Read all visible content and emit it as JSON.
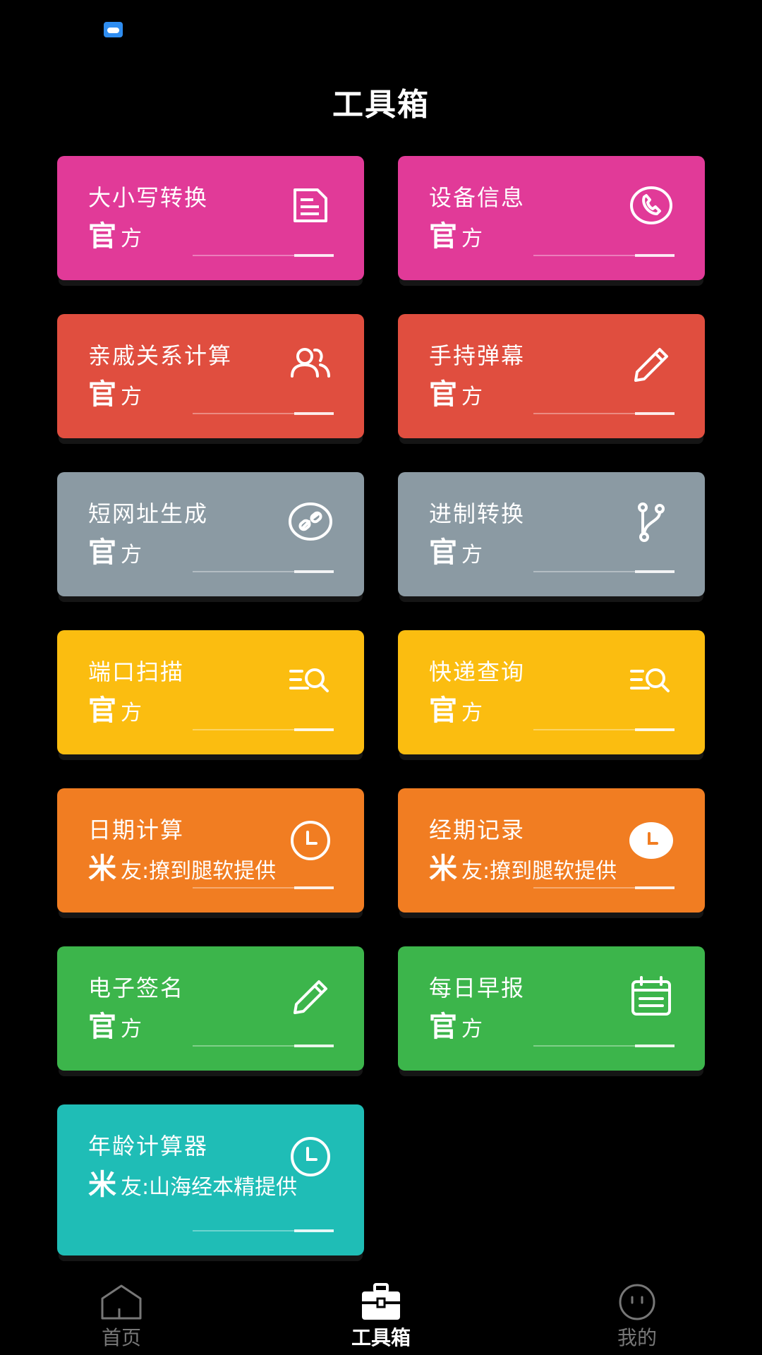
{
  "status_bar": {
    "notification_icon": "weather-app-icon"
  },
  "header": {
    "title": "工具箱"
  },
  "cards": [
    {
      "title": "大小写转换",
      "sub_big": "官",
      "sub_rest": "方",
      "icon": "document-icon",
      "color": "#e13a98"
    },
    {
      "title": "设备信息",
      "sub_big": "官",
      "sub_rest": "方",
      "icon": "phone-icon",
      "color": "#e13a98"
    },
    {
      "title": "亲戚关系计算",
      "sub_big": "官",
      "sub_rest": "方",
      "icon": "people-icon",
      "color": "#e04e3f"
    },
    {
      "title": "手持弹幕",
      "sub_big": "官",
      "sub_rest": "方",
      "icon": "pencil-icon",
      "color": "#e04e3f"
    },
    {
      "title": "短网址生成",
      "sub_big": "官",
      "sub_rest": "方",
      "icon": "link-icon",
      "color": "#8b9aa3"
    },
    {
      "title": "进制转换",
      "sub_big": "官",
      "sub_rest": "方",
      "icon": "branch-icon",
      "color": "#8b9aa3"
    },
    {
      "title": "端口扫描",
      "sub_big": "官",
      "sub_rest": "方",
      "icon": "list-search-icon",
      "color": "#fbbd10"
    },
    {
      "title": "快递查询",
      "sub_big": "官",
      "sub_rest": "方",
      "icon": "list-search-icon",
      "color": "#fbbd10"
    },
    {
      "title": "日期计算",
      "sub_big": "米",
      "sub_rest": "友:撩到腿软提供",
      "icon": "clock-icon",
      "color": "#f17d22"
    },
    {
      "title": "经期记录",
      "sub_big": "米",
      "sub_rest": "友:撩到腿软提供",
      "icon": "clock-filled-icon",
      "color": "#f17d22"
    },
    {
      "title": "电子签名",
      "sub_big": "官",
      "sub_rest": "方",
      "icon": "pencil-icon",
      "color": "#3cb54b"
    },
    {
      "title": "每日早报",
      "sub_big": "官",
      "sub_rest": "方",
      "icon": "calendar-icon",
      "color": "#3cb54b"
    },
    {
      "title": "年龄计算器",
      "sub_big": "米",
      "sub_rest": "友:山海经本精提供",
      "icon": "clock-icon",
      "color": "#1fbdb6"
    }
  ],
  "bottom_nav": {
    "items": [
      {
        "label": "首页",
        "icon": "home-icon",
        "active": false
      },
      {
        "label": "工具箱",
        "icon": "toolbox-icon",
        "active": true
      },
      {
        "label": "我的",
        "icon": "face-icon",
        "active": false
      }
    ]
  }
}
